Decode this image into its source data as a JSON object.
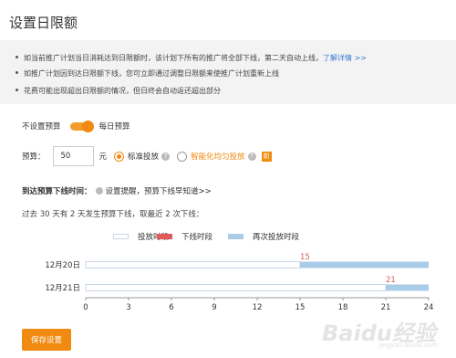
{
  "title": "设置日限额",
  "notices": [
    {
      "text": "如当前推广计划当日消耗达到日限额时，该计划下所有的推广将全部下线，第二天自动上线，",
      "link": "了解详情 >>"
    },
    {
      "text": "如推广计划因到达日限额下线，您可立即通过调整日限额来使推广计划重新上线",
      "link": ""
    },
    {
      "text": "花费可能出现超出日限额的情况，但日终会自动返还超出部分",
      "link": ""
    }
  ],
  "toggle": {
    "off_label": "不设置预算",
    "on_label": "每日预算",
    "state": "on"
  },
  "budget": {
    "label": "预算：",
    "value": "50",
    "unit": "元"
  },
  "delivery": {
    "standard_label": "标准投放",
    "standard_selected": true,
    "smart_label": "智能化均匀投放",
    "new_badge": "新",
    "help_icon": "?"
  },
  "offline": {
    "label": "到达预算下线时间：",
    "text": "设置提醒，预算下线早知道>>"
  },
  "summary": "过去 30 天有 2 天发生预算下线，取最近 2 次下线：",
  "legend": [
    {
      "label": "投放时段",
      "color": "#ffffff",
      "border": "#c9d7e6"
    },
    {
      "label": "下线时段",
      "color": "#e05a5a"
    },
    {
      "label": "再次投放时段",
      "color": "#a9cce8"
    }
  ],
  "chart_data": {
    "type": "bar",
    "categories": [
      "12月20日",
      "12月21日"
    ],
    "x_ticks": [
      0,
      3,
      6,
      9,
      12,
      15,
      18,
      21,
      24
    ],
    "xlim": [
      0,
      24
    ],
    "series": [
      {
        "name": "投放时段",
        "values": [
          [
            0,
            15
          ],
          [
            0,
            21
          ]
        ]
      },
      {
        "name": "再次投放时段",
        "values": [
          [
            15,
            24
          ],
          [
            21,
            24
          ]
        ]
      }
    ],
    "offline_markers": [
      15,
      21
    ],
    "colors": {
      "delivery": "#ffffff",
      "delivery_border": "#c9d7e6",
      "offline": "#e05a5a",
      "resume": "#a9cce8"
    }
  },
  "save_label": "保存设置",
  "watermark": "Baidu经验",
  "watermark_sub": "jingyan.baidu.com"
}
